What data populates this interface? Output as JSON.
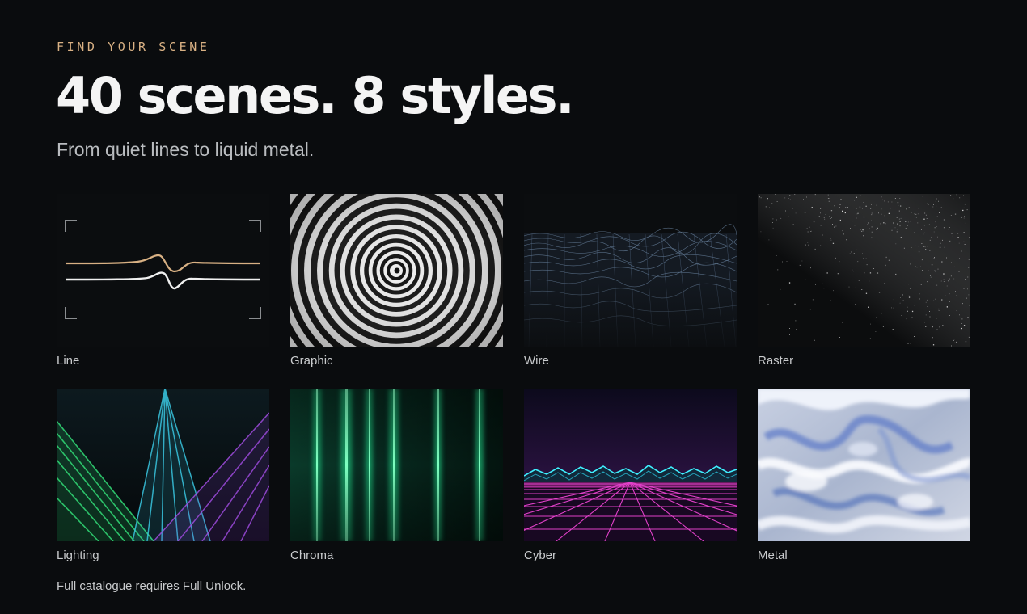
{
  "eyebrow": "FIND YOUR SCENE",
  "title": "40 scenes. 8 styles.",
  "subtitle": "From quiet lines to liquid metal.",
  "styles": [
    {
      "label": "Line",
      "icon": "line-scene-preview"
    },
    {
      "label": "Graphic",
      "icon": "concentric-rings-preview"
    },
    {
      "label": "Wire",
      "icon": "wireframe-mesh-preview"
    },
    {
      "label": "Raster",
      "icon": "particle-raster-preview"
    },
    {
      "label": "Lighting",
      "icon": "laser-beams-preview"
    },
    {
      "label": "Chroma",
      "icon": "green-light-bars-preview"
    },
    {
      "label": "Cyber",
      "icon": "synthwave-grid-preview"
    },
    {
      "label": "Metal",
      "icon": "liquid-metal-preview"
    }
  ],
  "footnote": "Full catalogue requires Full Unlock.",
  "colors": {
    "background": "#0a0c0e",
    "accent": "#d9b184",
    "text": "#f4f4f4",
    "muted": "#b9bcbf"
  }
}
